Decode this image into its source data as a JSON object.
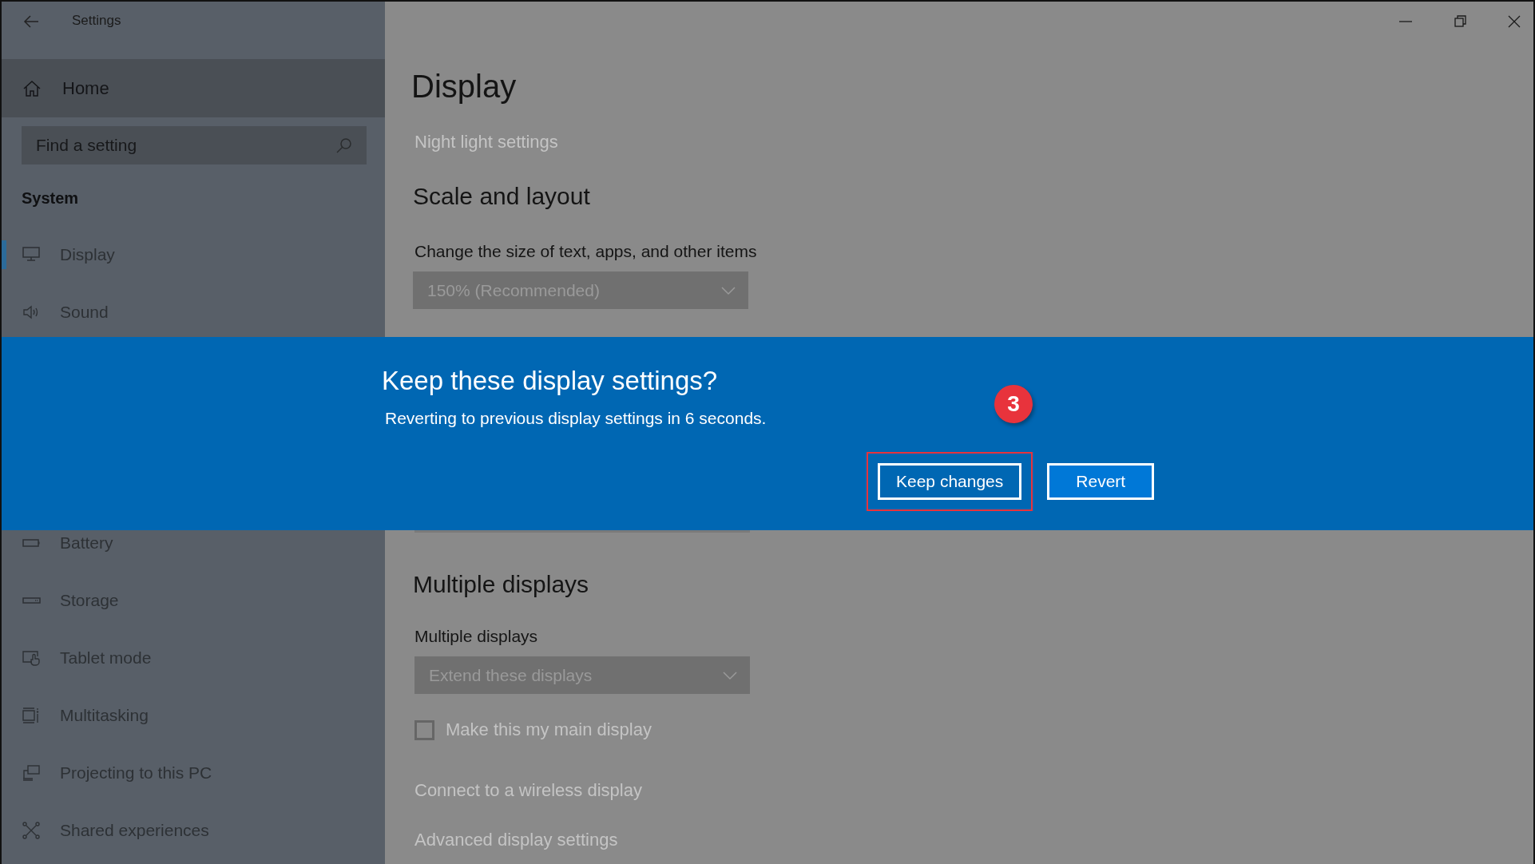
{
  "window": {
    "title": "Settings"
  },
  "sidebar": {
    "home": "Home",
    "search": {
      "placeholder": "Find a setting"
    },
    "section": "System",
    "items_above_dialog": [
      {
        "label": "Display",
        "selected": true
      },
      {
        "label": "Sound",
        "selected": false
      }
    ],
    "items_below_dialog": [
      {
        "label": "Battery",
        "selected": false
      },
      {
        "label": "Storage",
        "selected": false
      },
      {
        "label": "Tablet mode",
        "selected": false
      },
      {
        "label": "Multitasking",
        "selected": false
      },
      {
        "label": "Projecting to this PC",
        "selected": false
      },
      {
        "label": "Shared experiences",
        "selected": false
      }
    ]
  },
  "main": {
    "title": "Display",
    "night_light_link": "Night light settings",
    "scale_section": {
      "heading": "Scale and layout",
      "label": "Change the size of text, apps, and other items",
      "dropdown": "150% (Recommended)"
    },
    "multiple_section": {
      "heading": "Multiple displays",
      "label": "Multiple displays",
      "dropdown": "Extend these displays",
      "checkbox": {
        "label": "Make this my main display",
        "checked": false
      },
      "links": [
        "Connect to a wireless display",
        "Advanced display settings"
      ]
    }
  },
  "dialog": {
    "title": "Keep these display settings?",
    "message": "Reverting to previous display settings in  6 seconds.",
    "buttons": [
      {
        "label": "Keep changes",
        "highlighted": true
      },
      {
        "label": "Revert",
        "highlighted": false
      }
    ],
    "annotation": {
      "step": "3"
    }
  }
}
